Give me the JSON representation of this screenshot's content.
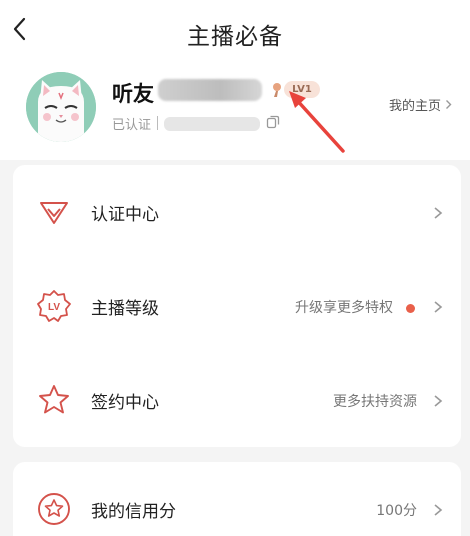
{
  "header": {
    "back_icon": "chevron-left-icon",
    "title": "主播必备"
  },
  "profile": {
    "avatar_icon": "cat-avatar",
    "name_prefix": "听友",
    "level_badge": "LV1",
    "verified_label": "已认证",
    "copy_icon": "copy-icon",
    "home_link": "我的主页"
  },
  "menu": {
    "items": [
      {
        "label": "认证中心",
        "extra": "",
        "icon": "diamond-badge-icon"
      },
      {
        "label": "主播等级",
        "extra": "升级享更多特权",
        "icon": "lv-badge-icon",
        "has_dot": true
      },
      {
        "label": "签约中心",
        "extra": "更多扶持资源",
        "icon": "star-badge-icon"
      }
    ]
  },
  "credit": {
    "label": "我的信用分",
    "value": "100分",
    "icon": "star-circle-icon"
  },
  "colors": {
    "accent_red": "#d4524b",
    "badge_bg": "#f8e2d8",
    "dot": "#e9604a",
    "annotation_arrow": "#e8433c"
  }
}
